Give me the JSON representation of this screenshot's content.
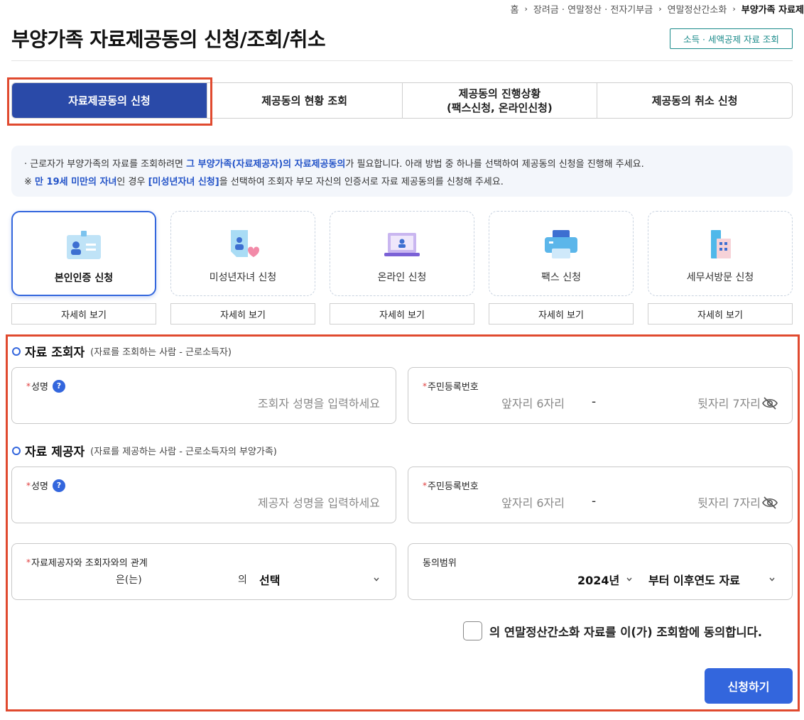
{
  "breadcrumb": {
    "items": [
      "홈",
      "장려금 · 연말정산 · 전자기부금",
      "연말정산간소화",
      "부양가족 자료제"
    ]
  },
  "page": {
    "title": "부양가족 자료제공동의 신청/조회/취소",
    "top_link": "소득 · 세액공제 자료 조회"
  },
  "tabs": [
    {
      "label": "자료제공동의 신청"
    },
    {
      "label": "제공동의 현황 조회"
    },
    {
      "label": "제공동의 진행상황\n(팩스신청, 온라인신청)"
    },
    {
      "label": "제공동의 취소 신청"
    }
  ],
  "notice": {
    "line1_prefix": "· 근로자가 부양가족의 자료를 조회하려면 ",
    "line1_highlight": "그 부양가족(자료제공자)의 자료제공동의",
    "line1_suffix": "가 필요합니다. 아래 방법 중 하나를 선택하여 제공동의 신청을 진행해 주세요.",
    "line2_prefix": "※ ",
    "line2_highlight1": "만 19세 미만의 자녀",
    "line2_mid": "인 경우 ",
    "line2_highlight2": "[미성년자녀 신청]",
    "line2_suffix": "을 선택하여 조회자 부모 자신의 인증서로 자료 제공동의를 신청해 주세요."
  },
  "methods": [
    {
      "label": "본인인증 신청",
      "icon": "id-card-icon",
      "detail": "자세히 보기"
    },
    {
      "label": "미성년자녀 신청",
      "icon": "child-document-icon",
      "detail": "자세히 보기"
    },
    {
      "label": "온라인 신청",
      "icon": "laptop-icon",
      "detail": "자세히 보기"
    },
    {
      "label": "팩스 신청",
      "icon": "fax-printer-icon",
      "detail": "자세히 보기"
    },
    {
      "label": "세무서방문 신청",
      "icon": "office-building-icon",
      "detail": "자세히 보기"
    }
  ],
  "viewer_section": {
    "title": "자료 조회자",
    "subtitle": "(자료를 조회하는 사람 - 근로소득자)",
    "name_label": "성명",
    "name_placeholder": "조회자 성명을 입력하세요",
    "rrn_label": "주민등록번호",
    "rrn_front_placeholder": "앞자리 6자리",
    "rrn_dash": "-",
    "rrn_back_placeholder": "뒷자리 7자리"
  },
  "provider_section": {
    "title": "자료 제공자",
    "subtitle": "(자료를 제공하는 사람 - 근로소득자의 부양가족)",
    "name_label": "성명",
    "name_placeholder": "제공자 성명을 입력하세요",
    "rrn_label": "주민등록번호",
    "rrn_front_placeholder": "앞자리 6자리",
    "rrn_dash": "-",
    "rrn_back_placeholder": "뒷자리 7자리"
  },
  "relation": {
    "label": "자료제공자와 조회자와의 관계",
    "subject_text": "은(는)",
    "of_text": "의",
    "select_value": "선택"
  },
  "consent_range": {
    "label": "동의범위",
    "year_value": "2024년",
    "scope_value": "부터 이후연도 자료"
  },
  "consent": {
    "text": "의 연말정산간소화 자료를 이(가) 조회함에 동의합니다."
  },
  "submit": {
    "label": "신청하기"
  },
  "colors": {
    "primary": "#3366dd",
    "tab_active": "#2a4aa8",
    "highlight_border": "#e04a2f",
    "required": "#e03c3c",
    "link_teal": "#1a8a8a"
  }
}
